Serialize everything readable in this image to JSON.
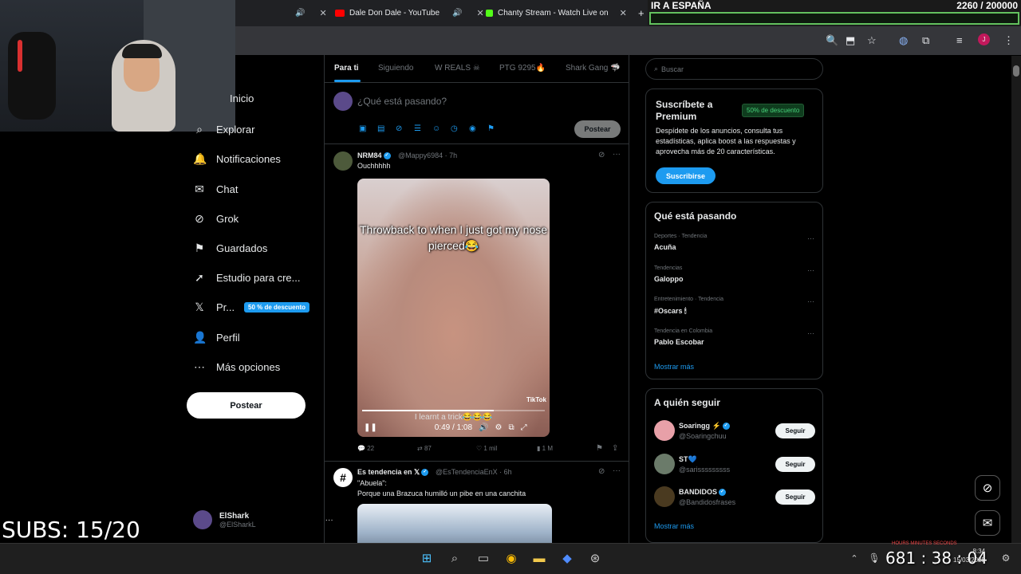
{
  "browser": {
    "tabs": [
      {
        "title": "Dale Don Dale - YouTube",
        "icon_color": "#ff0000"
      },
      {
        "title": "Chanty Stream - Watch Live on",
        "icon_color": "#53fc18"
      }
    ],
    "new_tab": "+",
    "avatar_letter": "J"
  },
  "goal": {
    "title": "IR A ESPAÑA",
    "count": "2260  / 200000"
  },
  "subs_overlay": "SUBS: 15/20",
  "nav": {
    "items": [
      {
        "label": "Inicio",
        "icon": "home-icon",
        "glyph": "⌂"
      },
      {
        "label": "Explorar",
        "icon": "search-icon",
        "glyph": "⌕"
      },
      {
        "label": "Notificaciones",
        "icon": "bell-icon",
        "glyph": "🔔"
      },
      {
        "label": "Chat",
        "icon": "mail-icon",
        "glyph": "✉"
      },
      {
        "label": "Grok",
        "icon": "grok-icon",
        "glyph": "⊘"
      },
      {
        "label": "Guardados",
        "icon": "bookmark-icon",
        "glyph": "⚑"
      },
      {
        "label": "Estudio para cre...",
        "icon": "rocket-icon",
        "glyph": "➚"
      },
      {
        "label": "Pr...",
        "icon": "x-logo-icon",
        "glyph": "𝕏"
      },
      {
        "label": "Perfil",
        "icon": "person-icon",
        "glyph": "👤"
      },
      {
        "label": "Más opciones",
        "icon": "more-circle-icon",
        "glyph": "⋯"
      }
    ],
    "premium_badge": "50 % de descuento",
    "post_button": "Postear",
    "account": {
      "name": "ElShark",
      "handle": "@ElSharkL",
      "more": "···"
    }
  },
  "timeline": {
    "tabs": [
      "Para ti",
      "Siguiendo",
      "W REALS ☠",
      "PTG 9295🔥",
      "Shark Gang 🦈"
    ],
    "composer": {
      "placeholder": "¿Qué está pasando?",
      "post_button": "Postear"
    },
    "posts": [
      {
        "name": "NRM84",
        "handle": "@Mappy6984 · 7h",
        "text": "Ouchhhhh",
        "video": {
          "caption": "Throwback to when I just got my nose pierced😂",
          "subtitle": "I learnt a trick😂😂😂",
          "watermark": "TikTok",
          "time": "0:49 / 1:08",
          "progress": 0.72
        },
        "actions": {
          "replies": "22",
          "reposts": "87",
          "likes": "1 mil",
          "views": "1 M"
        }
      },
      {
        "name": "Es tendencia en 𝕏",
        "handle": "@EsTendenciaEnX · 6h",
        "text_line1": "\"Abuela\":",
        "text_line2": "Porque una Brazuca humilló un pibe en una canchita"
      }
    ]
  },
  "right": {
    "search_placeholder": "Buscar",
    "premium": {
      "title": "Suscríbete a Premium",
      "badge": "50% de descuento",
      "desc": "Despídete de los anuncios, consulta tus estadísticas, aplica boost a las respuestas y aprovecha más de 20 características.",
      "button": "Suscribirse"
    },
    "trends": {
      "title": "Qué está pasando",
      "items": [
        {
          "category": "Deportes · Tendencia",
          "name": "Acuña"
        },
        {
          "category": "Tendencias",
          "name": "Galoppo"
        },
        {
          "category": "Entretenimiento · Tendencia",
          "name": "#Oscars 🕯"
        },
        {
          "category": "Tendencia en Colombia",
          "name": "Pablo Escobar"
        }
      ],
      "show_more": "Mostrar más"
    },
    "who_to_follow": {
      "title": "A quién seguir",
      "items": [
        {
          "name": "Soaringg ⚡",
          "handle": "@Soaringchuu",
          "button": "Seguir",
          "color": "#e8a0a8"
        },
        {
          "name": "ST💙",
          "handle": "@sarisssssssss",
          "button": "Seguir",
          "color": "#6b7b6a"
        },
        {
          "name": "BANDIDOS",
          "handle": "@Bandidosfrases",
          "button": "Seguir",
          "color": "#4a3a20"
        }
      ],
      "show_more": "Mostrar más"
    }
  },
  "taskbar": {
    "time": "8:34",
    "date": "15/03/2025",
    "counter": "681 : 38 : 04",
    "counter_labels": "HOURS    MINUTES    SECONDS"
  }
}
